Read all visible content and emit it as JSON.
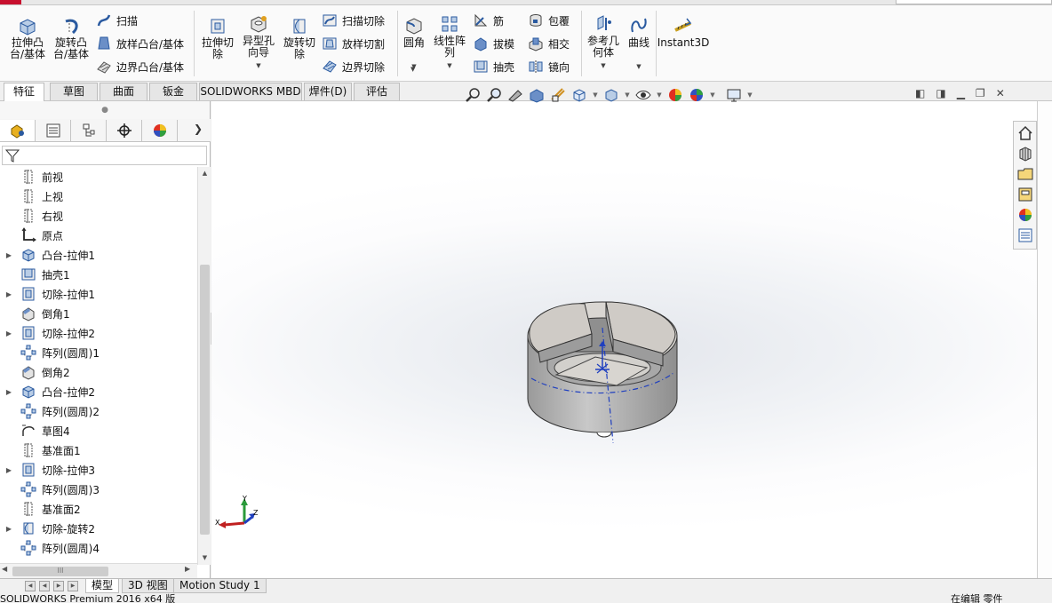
{
  "ribbon": {
    "extrude_boss": "拉伸凸\n台/基体",
    "revolve_boss": "旋转凸\n台/基体",
    "sweep": "扫描",
    "loft_boss": "放样凸台/基体",
    "boundary_boss": "边界凸台/基体",
    "extrude_cut": "拉伸切\n除",
    "hole_wizard": "异型孔\n向导",
    "revolve_cut": "旋转切\n除",
    "sweep_cut": "扫描切除",
    "loft_cut": "放样切割",
    "boundary_cut": "边界切除",
    "fillet": "圆角",
    "linear_pattern": "线性阵\n列",
    "rib": "筋",
    "draft": "拔模",
    "shell": "抽壳",
    "wrap": "包覆",
    "intersect": "相交",
    "mirror": "镜向",
    "ref_geometry": "参考几\n何体",
    "curves": "曲线",
    "instant3d": "Instant3D"
  },
  "tabs": [
    "特征",
    "草图",
    "曲面",
    "钣金",
    "SOLIDWORKS MBD",
    "焊件(D)",
    "评估"
  ],
  "tree": [
    {
      "label": "前视",
      "icon": "plane-icon",
      "expand": false
    },
    {
      "label": "上视",
      "icon": "plane-icon",
      "expand": false
    },
    {
      "label": "右视",
      "icon": "plane-icon",
      "expand": false
    },
    {
      "label": "原点",
      "icon": "origin-icon",
      "expand": false
    },
    {
      "label": "凸台-拉伸1",
      "icon": "boss-extrude-icon",
      "expand": true
    },
    {
      "label": "抽壳1",
      "icon": "shell-icon",
      "expand": false
    },
    {
      "label": "切除-拉伸1",
      "icon": "cut-extrude-icon",
      "expand": true
    },
    {
      "label": "倒角1",
      "icon": "chamfer-icon",
      "expand": false
    },
    {
      "label": "切除-拉伸2",
      "icon": "cut-extrude-icon",
      "expand": true
    },
    {
      "label": "阵列(圆周)1",
      "icon": "circular-pattern-icon",
      "expand": false
    },
    {
      "label": "倒角2",
      "icon": "chamfer-icon",
      "expand": false
    },
    {
      "label": "凸台-拉伸2",
      "icon": "boss-extrude-icon",
      "expand": true
    },
    {
      "label": "阵列(圆周)2",
      "icon": "circular-pattern-icon",
      "expand": false
    },
    {
      "label": "草图4",
      "icon": "sketch-icon",
      "expand": false
    },
    {
      "label": "基准面1",
      "icon": "plane-icon",
      "expand": false
    },
    {
      "label": "切除-拉伸3",
      "icon": "cut-extrude-icon",
      "expand": true
    },
    {
      "label": "阵列(圆周)3",
      "icon": "circular-pattern-icon",
      "expand": false
    },
    {
      "label": "基准面2",
      "icon": "plane-icon",
      "expand": false
    },
    {
      "label": "切除-旋转2",
      "icon": "cut-revolve-icon",
      "expand": true
    },
    {
      "label": "阵列(圆周)4",
      "icon": "circular-pattern-icon",
      "expand": false
    }
  ],
  "bottom_tabs": [
    "模型",
    "3D 视图",
    "Motion Study 1"
  ],
  "status": {
    "left": "SOLIDWORKS Premium 2016 x64 版",
    "right": "在编辑 零件"
  },
  "triad": {
    "x": "X",
    "y": "Y",
    "z": "Z"
  },
  "hscroll_grip": "III",
  "colors": {
    "accent_blue": "#1f5fbf",
    "part_gray": "#a9a9a9",
    "brand_red": "#c8102e"
  }
}
